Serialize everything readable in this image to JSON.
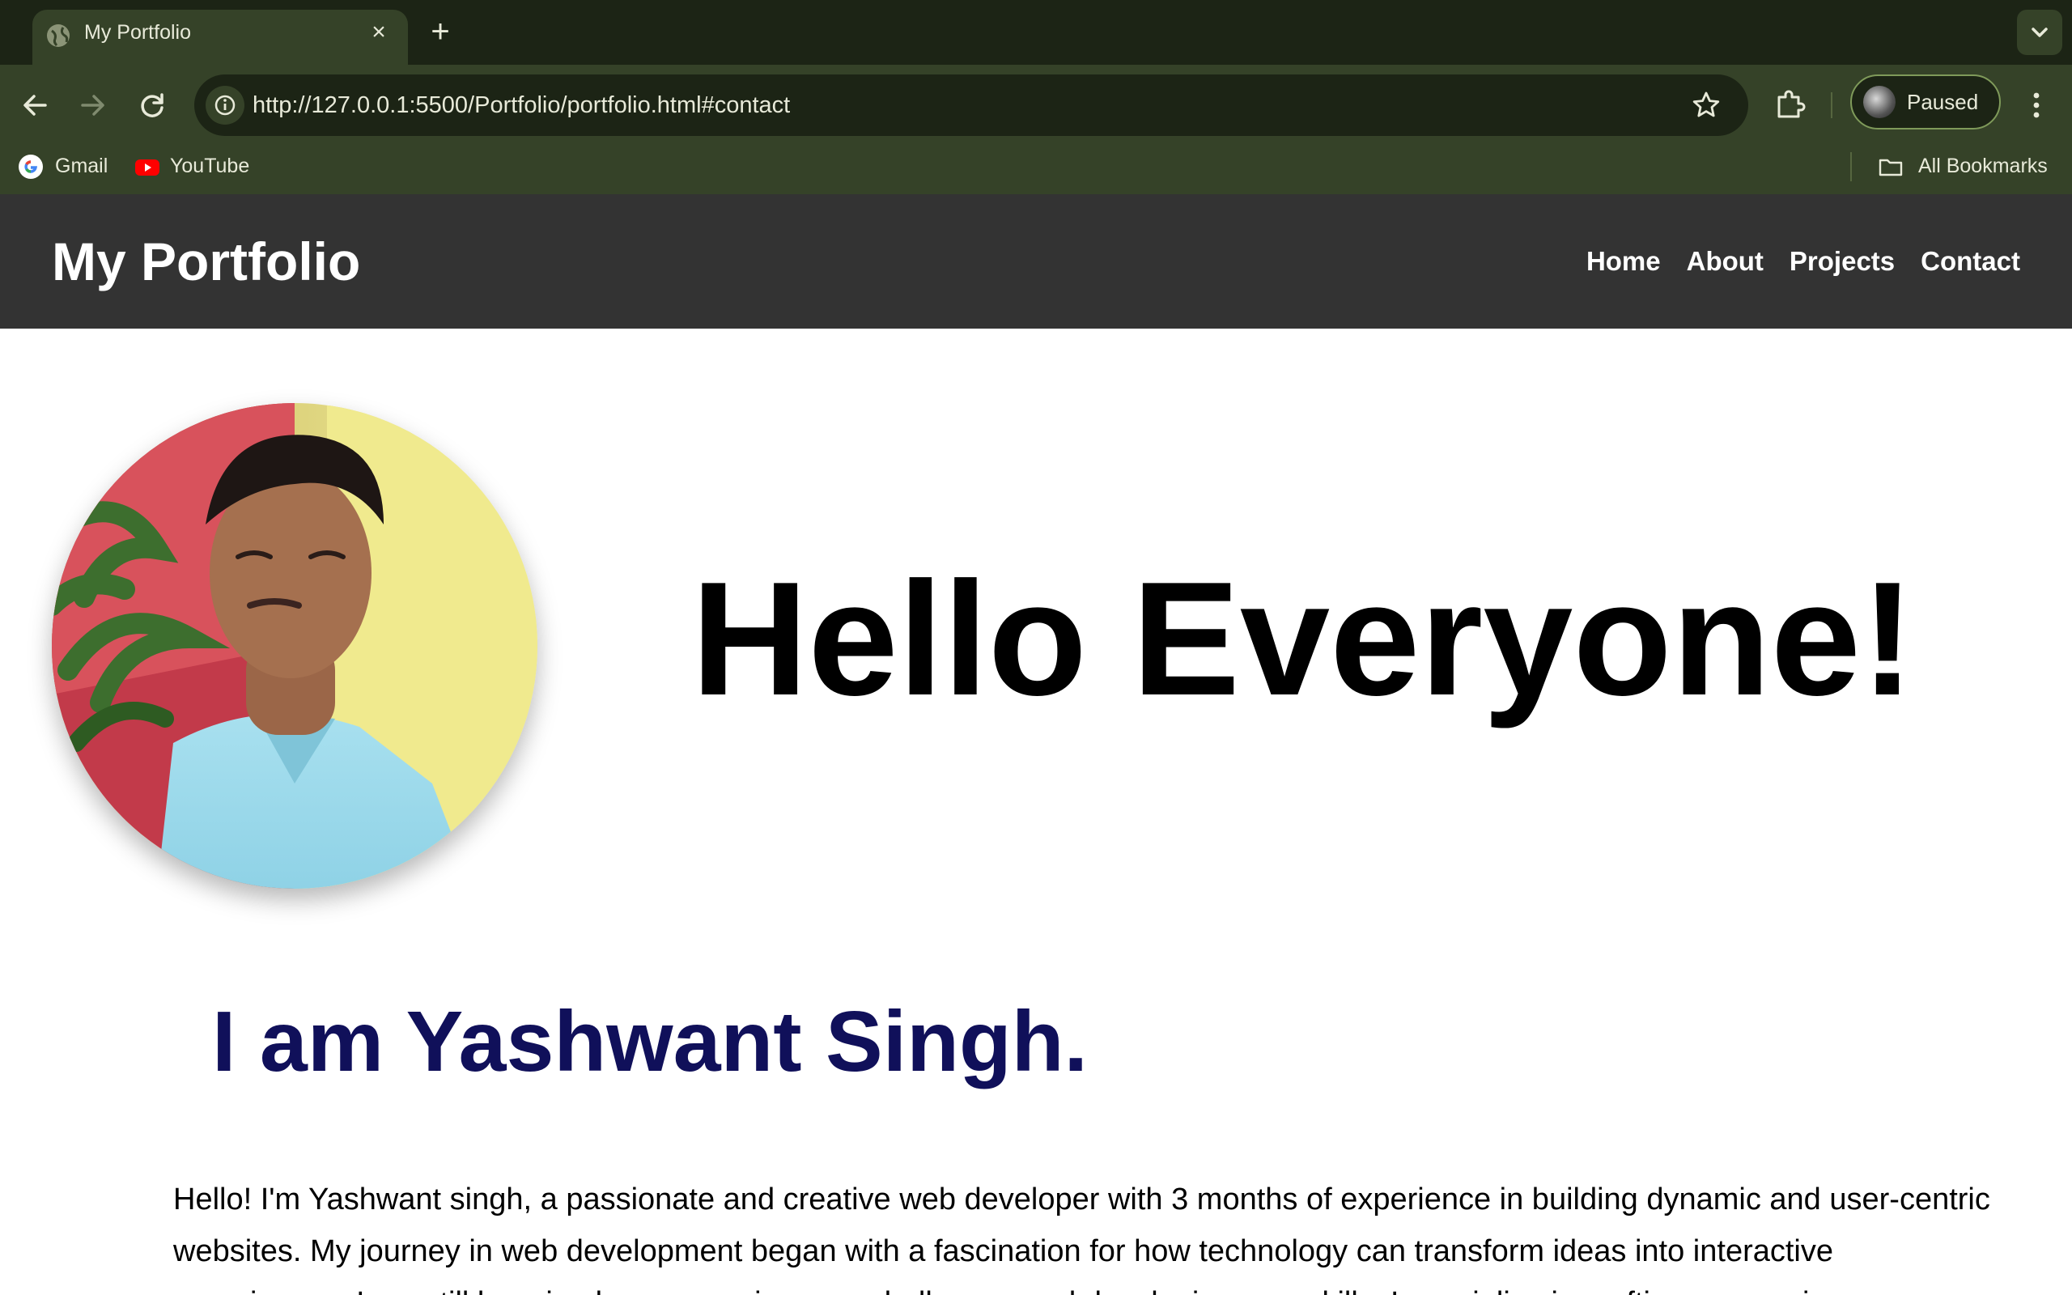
{
  "browser": {
    "tab": {
      "title": "My Portfolio",
      "close_icon": "close-icon",
      "favicon": "globe-icon"
    },
    "new_tab_icon": "plus-icon",
    "tab_search_icon": "chevron-down-icon",
    "nav": {
      "back_icon": "arrow-left-icon",
      "forward_icon": "arrow-right-icon",
      "reload_icon": "reload-icon"
    },
    "omnibox": {
      "url": "http://127.0.0.1:5500/Portfolio/portfolio.html#contact",
      "site_info_icon": "info-icon",
      "bookmark_icon": "star-icon"
    },
    "extensions_icon": "puzzle-icon",
    "profile": {
      "label": "Paused"
    },
    "menu_icon": "kebab-menu-icon",
    "bookmarks": [
      {
        "label": "Gmail",
        "icon": "google-icon"
      },
      {
        "label": "YouTube",
        "icon": "youtube-icon"
      }
    ],
    "all_bookmarks": {
      "label": "All Bookmarks",
      "icon": "folder-icon"
    }
  },
  "page": {
    "site_title": "My Portfolio",
    "nav": [
      {
        "label": "Home"
      },
      {
        "label": "About"
      },
      {
        "label": "Projects"
      },
      {
        "label": "Contact"
      }
    ],
    "hero_heading": "Hello Everyone!",
    "intro_heading": "I am Yashwant Singh.",
    "bio": "Hello! I'm Yashwant singh, a passionate and creative web developer with 3 months of experience in building dynamic and user-centric websites. My journey in web development began with a fascination for how technology can transform ideas into interactive experiences. I am still learning by overcoming new challenges and developing new skills. I specialize in crafting responsive"
  },
  "colors": {
    "tabstrip": "#1c2415",
    "toolbar": "#354228",
    "header": "#333333",
    "intro_heading": "#10105a"
  }
}
